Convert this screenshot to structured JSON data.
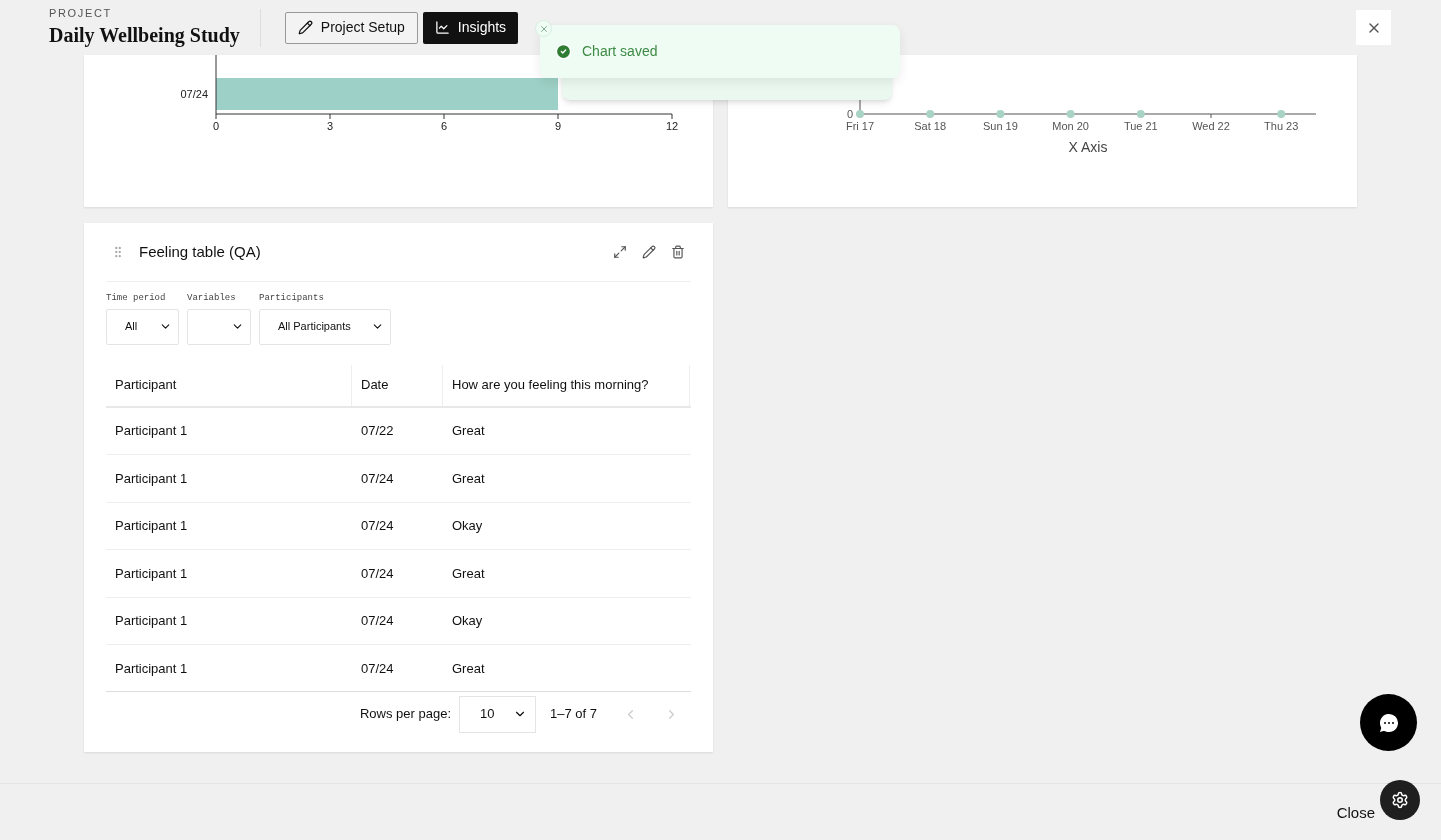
{
  "header": {
    "eyebrow": "PROJECT",
    "title": "Daily Wellbeing Study",
    "tabs": [
      {
        "label": "Project Setup",
        "selected": false
      },
      {
        "label": "Insights",
        "selected": true
      }
    ]
  },
  "toast": {
    "message": "Chart saved"
  },
  "bar_chart": {
    "chart_data": {
      "type": "bar",
      "orientation": "horizontal",
      "categories": [
        "07/24"
      ],
      "xlim": [
        0,
        12
      ],
      "xticks": [
        0,
        3,
        6,
        9,
        12
      ],
      "series": [
        {
          "color": "#9dd0c6",
          "values": [
            9
          ]
        }
      ]
    }
  },
  "line_chart": {
    "y_axis_label": "0",
    "x_axis_title": "X Axis",
    "x_labels": [
      {
        "label": "Fri 17",
        "point": true
      },
      {
        "label": "Sat 18",
        "point": true
      },
      {
        "label": "Sun 19",
        "point": true
      },
      {
        "label": "Mon 20",
        "point": true
      },
      {
        "label": "Tue 21",
        "point": true
      },
      {
        "label": "Wed 22",
        "point": false
      },
      {
        "label": "Thu 23",
        "point": true
      }
    ]
  },
  "table_card": {
    "title": "Feeling table (QA)",
    "filters": [
      {
        "label": "Time period",
        "value": "All"
      },
      {
        "label": "Variables"
      },
      {
        "label": "Participants",
        "value": "All Participants"
      }
    ],
    "columns": [
      "Participant",
      "Date",
      "How are you feeling this morning?"
    ],
    "rows": [
      [
        "Participant 1",
        "07/22",
        "Great"
      ],
      [
        "Participant 1",
        "07/24",
        "Great"
      ],
      [
        "Participant 1",
        "07/24",
        "Okay"
      ],
      [
        "Participant 1",
        "07/24",
        "Great"
      ],
      [
        "Participant 1",
        "07/24",
        "Okay"
      ],
      [
        "Participant 1",
        "07/24",
        "Great"
      ]
    ],
    "pagination": {
      "rows_label": "Rows per page:",
      "rows_value": "10",
      "range": "1–7 of 7"
    }
  },
  "footer": {
    "close": "Close"
  }
}
